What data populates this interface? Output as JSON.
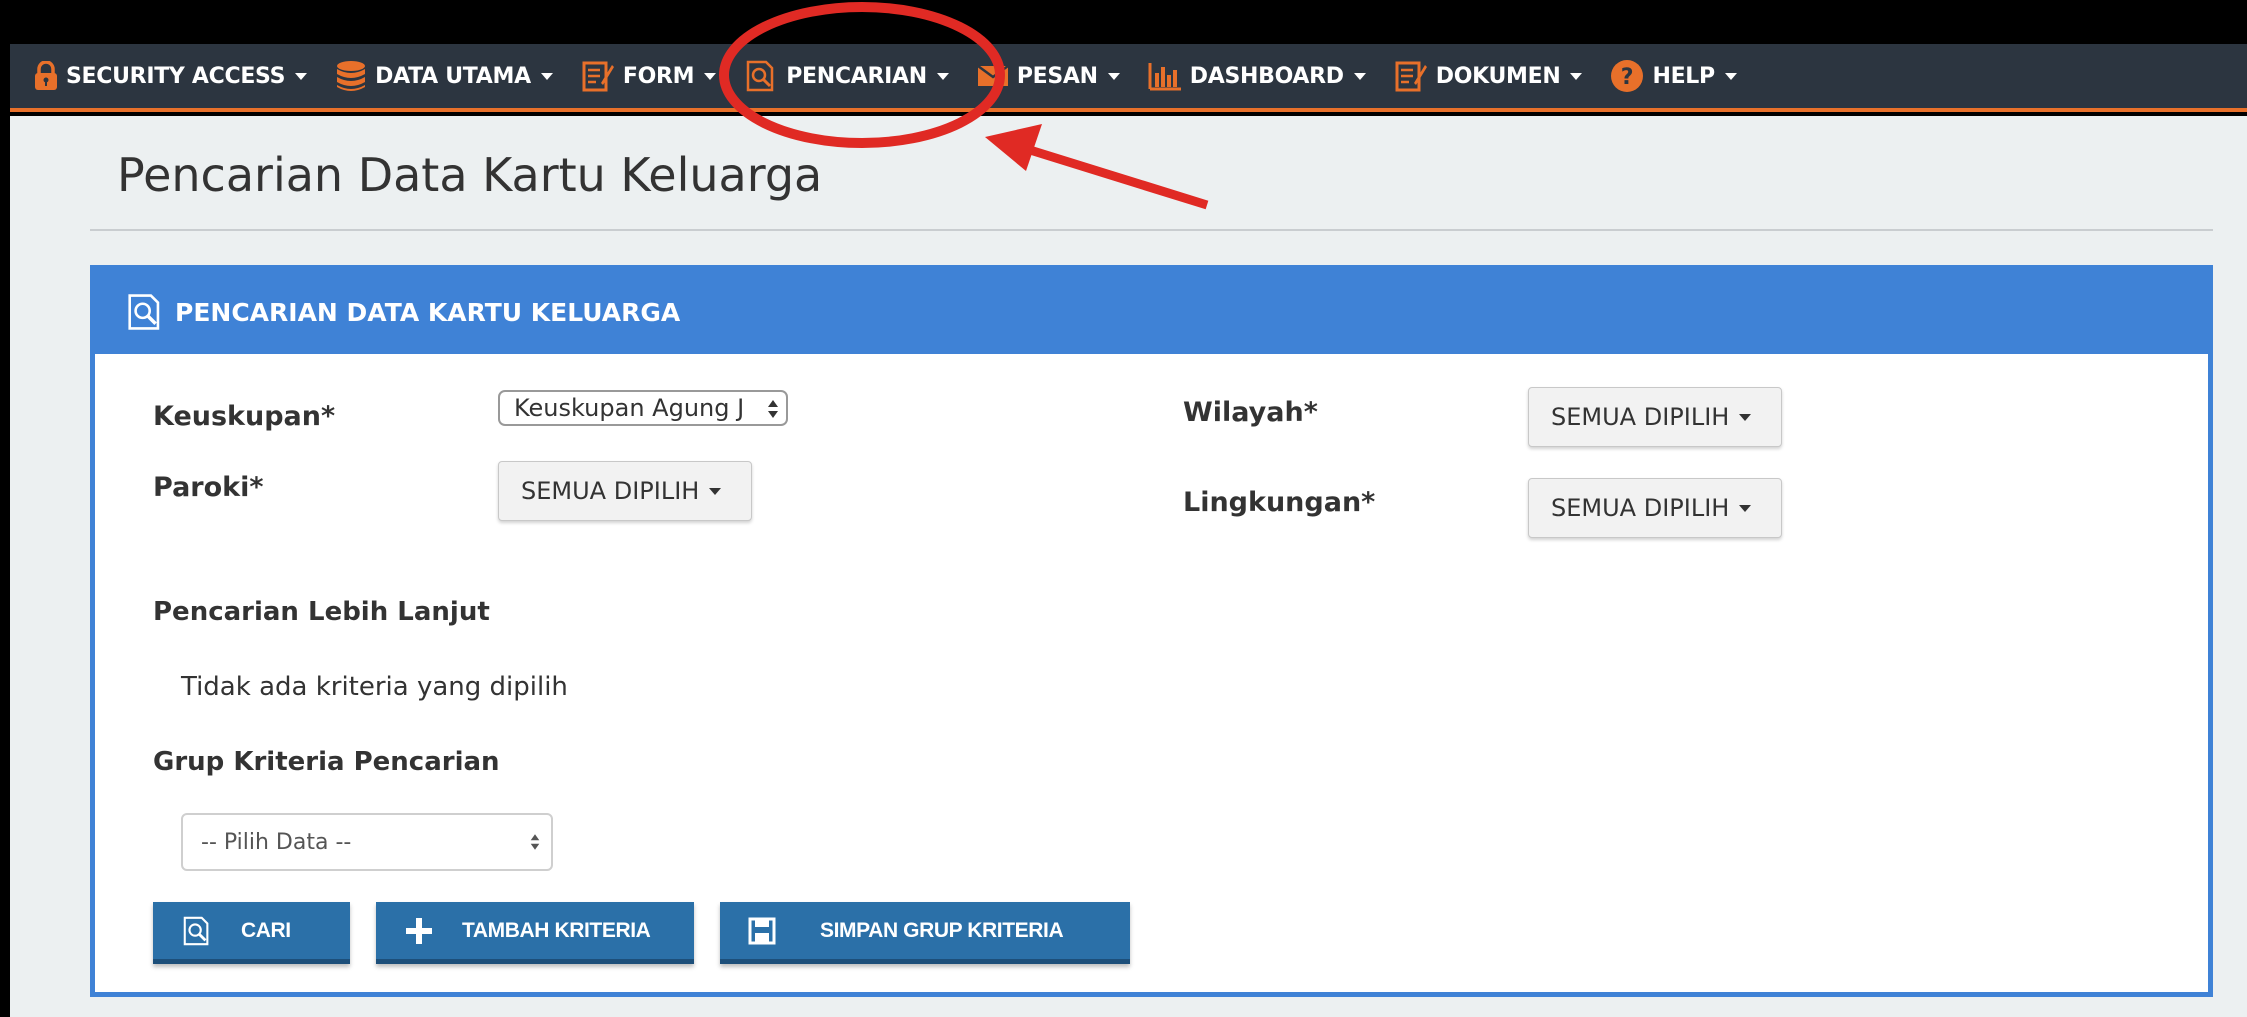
{
  "colors": {
    "navbar_bg": "#2c3540",
    "navbar_accent": "#e8702a",
    "icon_orange": "#e8702a",
    "panel_blue": "#3f82d6",
    "button_blue": "#2b70a8",
    "annotation_red": "#e02a24"
  },
  "navbar": {
    "items": [
      {
        "label": "SECURITY ACCESS",
        "icon": "lock-icon"
      },
      {
        "label": "DATA UTAMA",
        "icon": "database-icon"
      },
      {
        "label": "FORM",
        "icon": "form-icon"
      },
      {
        "label": "PENCARIAN",
        "icon": "search-document-icon"
      },
      {
        "label": "PESAN",
        "icon": "envelope-icon"
      },
      {
        "label": "DASHBOARD",
        "icon": "bar-chart-icon"
      },
      {
        "label": "DOKUMEN",
        "icon": "document-icon"
      },
      {
        "label": "HELP",
        "icon": "help-icon"
      }
    ]
  },
  "page": {
    "title": "Pencarian Data Kartu Keluarga"
  },
  "panel": {
    "heading": "PENCARIAN DATA KARTU KELUARGA",
    "heading_icon": "search-document-icon",
    "fields": {
      "keuskupan_label": "Keuskupan*",
      "keuskupan_value": "Keuskupan Agung J",
      "paroki_label": "Paroki*",
      "paroki_value": "SEMUA DIPILIH",
      "wilayah_label": "Wilayah*",
      "wilayah_value": "SEMUA DIPILIH",
      "lingkungan_label": "Lingkungan*",
      "lingkungan_value": "SEMUA DIPILIH"
    },
    "advanced": {
      "heading": "Pencarian Lebih Lanjut",
      "empty_text": "Tidak ada kriteria yang dipilih"
    },
    "group": {
      "heading": "Grup Kriteria Pencarian",
      "placeholder": "-- Pilih Data --"
    },
    "buttons": {
      "search": "CARI",
      "add_criteria": "TAMBAH KRITERIA",
      "save_group": "SIMPAN GRUP KRITERIA"
    }
  }
}
